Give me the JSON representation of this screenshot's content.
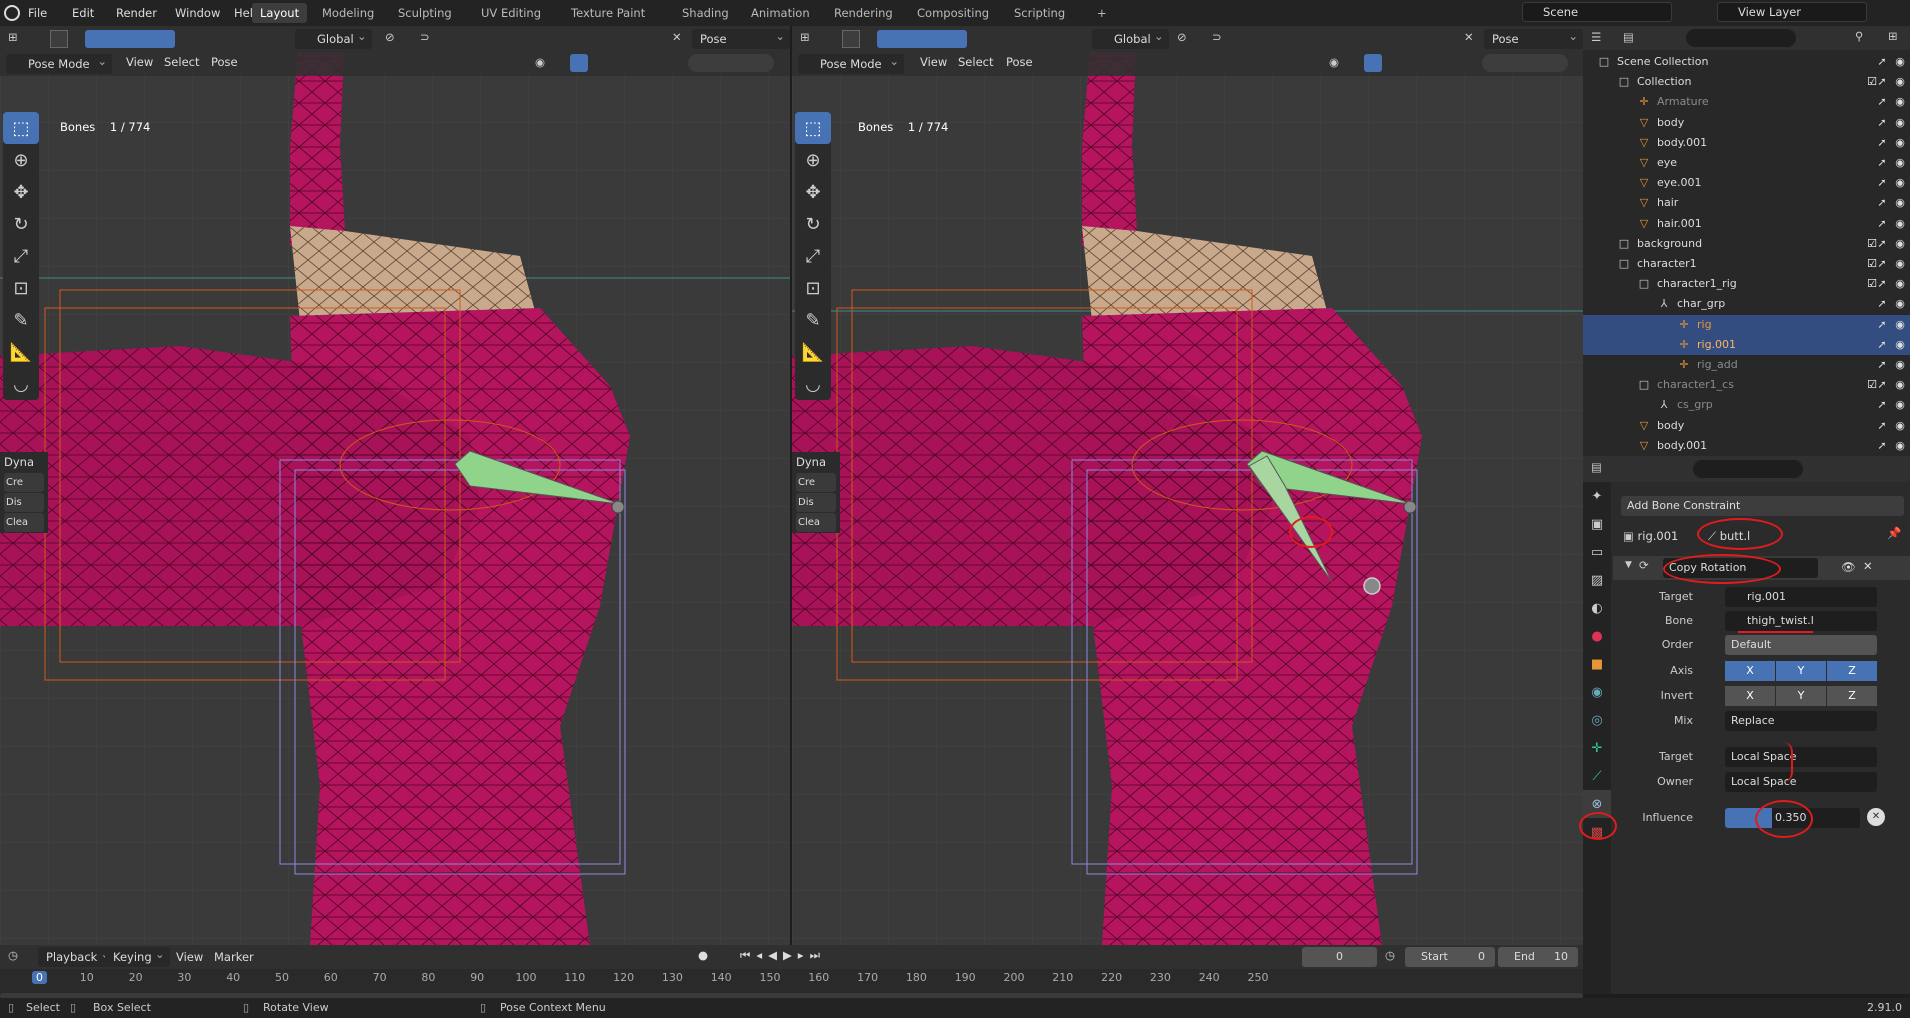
{
  "topbar": {
    "menus": [
      "File",
      "Edit",
      "Render",
      "Window",
      "Help"
    ],
    "workspaces": [
      "Layout",
      "Modeling",
      "Sculpting",
      "UV Editing",
      "Texture Paint",
      "Shading",
      "Animation",
      "Rendering",
      "Compositing",
      "Scripting",
      "+"
    ],
    "active_workspace": "Layout",
    "scene": "Scene",
    "view_layer": "View Layer"
  },
  "viewport_left": {
    "transform": "Global",
    "mode": "Pose Mode",
    "menus": [
      "View",
      "Select",
      "Pose"
    ],
    "pose_options": "Pose Options",
    "bones_label": "Bones",
    "bones_count": "1 / 774",
    "dyna": {
      "title": "Dyna",
      "items": [
        "Cre",
        "Dis",
        "Clea"
      ]
    }
  },
  "viewport_right": {
    "transform": "Global",
    "mode": "Pose Mode",
    "menus": [
      "View",
      "Select",
      "Pose"
    ],
    "pose_options": "Pose Options",
    "bones_label": "Bones",
    "bones_count": "1 / 774",
    "dyna": {
      "title": "Dyna",
      "items": [
        "Cre",
        "Dis",
        "Clea"
      ]
    }
  },
  "outliner": {
    "rows": [
      {
        "label": "Scene Collection",
        "depth": 0,
        "icon": "□",
        "color": "#ddd"
      },
      {
        "label": "Collection",
        "depth": 1,
        "icon": "□",
        "color": "#ddd",
        "check": true
      },
      {
        "label": "Armature",
        "depth": 2,
        "icon": "✛",
        "color": "#8a8a8a"
      },
      {
        "label": "body",
        "depth": 2,
        "icon": "▽",
        "color": "#ddd"
      },
      {
        "label": "body.001",
        "depth": 2,
        "icon": "▽",
        "color": "#ddd"
      },
      {
        "label": "eye",
        "depth": 2,
        "icon": "▽",
        "color": "#ddd"
      },
      {
        "label": "eye.001",
        "depth": 2,
        "icon": "▽",
        "color": "#ddd"
      },
      {
        "label": "hair",
        "depth": 2,
        "icon": "▽",
        "color": "#ddd"
      },
      {
        "label": "hair.001",
        "depth": 2,
        "icon": "▽",
        "color": "#ddd"
      },
      {
        "label": "background",
        "depth": 1,
        "icon": "□",
        "color": "#ddd",
        "check": true
      },
      {
        "label": "character1",
        "depth": 1,
        "icon": "□",
        "color": "#ddd",
        "check": true
      },
      {
        "label": "character1_rig",
        "depth": 2,
        "icon": "□",
        "color": "#ddd",
        "check": true
      },
      {
        "label": "char_grp",
        "depth": 3,
        "icon": "⅄",
        "color": "#ddd"
      },
      {
        "label": "rig",
        "depth": 4,
        "icon": "✛",
        "color": "#e8953a",
        "selected": true
      },
      {
        "label": "rig.001",
        "depth": 4,
        "icon": "✛",
        "color": "#ffb35c",
        "selected": true
      },
      {
        "label": "rig_add",
        "depth": 4,
        "icon": "✛",
        "color": "#8a8a8a"
      },
      {
        "label": "character1_cs",
        "depth": 2,
        "icon": "□",
        "color": "#8a8a8a",
        "check": true
      },
      {
        "label": "cs_grp",
        "depth": 3,
        "icon": "⅄",
        "color": "#8a8a8a"
      },
      {
        "label": "body",
        "depth": 2,
        "icon": "▽",
        "color": "#ddd"
      },
      {
        "label": "body.001",
        "depth": 2,
        "icon": "▽",
        "color": "#ddd"
      }
    ]
  },
  "properties": {
    "add_constraint": "Add Bone Constraint",
    "object": "rig.001",
    "bone": "butt.l",
    "constraint_name": "Copy Rotation",
    "target_label": "Target",
    "target_value": "rig.001",
    "bone_label": "Bone",
    "bone_value": "thigh_twist.l",
    "order_label": "Order",
    "order_value": "Default",
    "axis_label": "Axis",
    "invert_label": "Invert",
    "axes": [
      "X",
      "Y",
      "Z"
    ],
    "mix_label": "Mix",
    "mix_value": "Replace",
    "space_target_label": "Target",
    "space_target_value": "Local Space",
    "owner_label": "Owner",
    "owner_value": "Local Space",
    "influence_label": "Influence",
    "influence_value": "0.350",
    "influence": 0.35
  },
  "timeline": {
    "menus": [
      "Playback",
      "Keying",
      "View",
      "Marker"
    ],
    "current_frame": "0",
    "start_label": "Start",
    "start": "0",
    "end_label": "End",
    "end": "10",
    "ticks": [
      "0",
      "10",
      "20",
      "30",
      "40",
      "50",
      "60",
      "70",
      "80",
      "90",
      "100",
      "110",
      "120",
      "130",
      "140",
      "150",
      "160",
      "170",
      "180",
      "190",
      "200",
      "210",
      "220",
      "230",
      "240",
      "250"
    ]
  },
  "statusbar": {
    "items": [
      "Select",
      "Box Select",
      "Rotate View",
      "Pose Context Menu"
    ],
    "version": "2.91.0"
  },
  "colors": {
    "accent": "#4772b3",
    "mesh": "#b5145e",
    "skin": "#c9a98c",
    "bone": "#8fd48a",
    "annotation": "#e01c1c"
  }
}
